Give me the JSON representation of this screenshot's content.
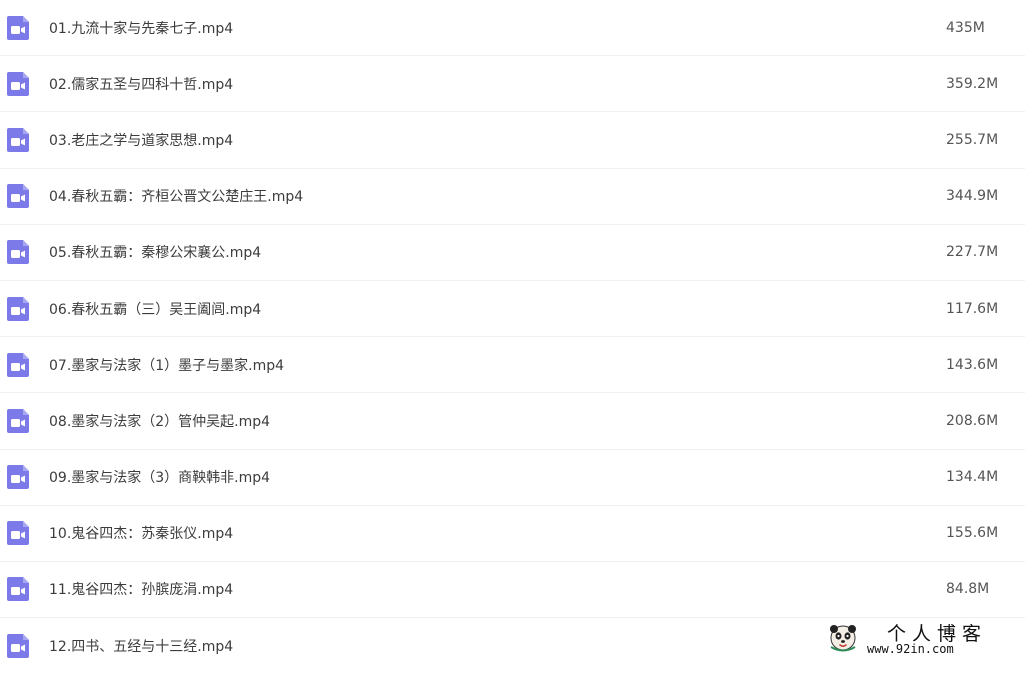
{
  "files": [
    {
      "name": "01.九流十家与先秦七子.mp4",
      "size": "435M",
      "icon": "video-file-icon"
    },
    {
      "name": "02.儒家五圣与四科十哲.mp4",
      "size": "359.2M",
      "icon": "video-file-icon"
    },
    {
      "name": "03.老庄之学与道家思想.mp4",
      "size": "255.7M",
      "icon": "video-file-icon"
    },
    {
      "name": "04.春秋五霸：齐桓公晋文公楚庄王.mp4",
      "size": "344.9M",
      "icon": "video-file-icon"
    },
    {
      "name": "05.春秋五霸：秦穆公宋襄公.mp4",
      "size": "227.7M",
      "icon": "video-file-icon"
    },
    {
      "name": "06.春秋五霸（三）吴王阖闾.mp4",
      "size": "117.6M",
      "icon": "video-file-icon"
    },
    {
      "name": "07.墨家与法家（1）墨子与墨家.mp4",
      "size": "143.6M",
      "icon": "video-file-icon"
    },
    {
      "name": "08.墨家与法家（2）管仲吴起.mp4",
      "size": "208.6M",
      "icon": "video-file-icon"
    },
    {
      "name": "09.墨家与法家（3）商鞅韩非.mp4",
      "size": "134.4M",
      "icon": "video-file-icon"
    },
    {
      "name": "10.鬼谷四杰：苏秦张仪.mp4",
      "size": "155.6M",
      "icon": "video-file-icon"
    },
    {
      "name": "11.鬼谷四杰：孙膑庞涓.mp4",
      "size": "84.8M",
      "icon": "video-file-icon"
    },
    {
      "name": "12.四书、五经与十三经.mp4",
      "size": "",
      "icon": "video-file-icon"
    }
  ],
  "colors": {
    "icon_fill": "#7c79e8",
    "row_divider": "#f0f0f2",
    "text": "#3c3c3c"
  },
  "watermark": {
    "title": "个人博客",
    "url": "www.92in.com"
  }
}
